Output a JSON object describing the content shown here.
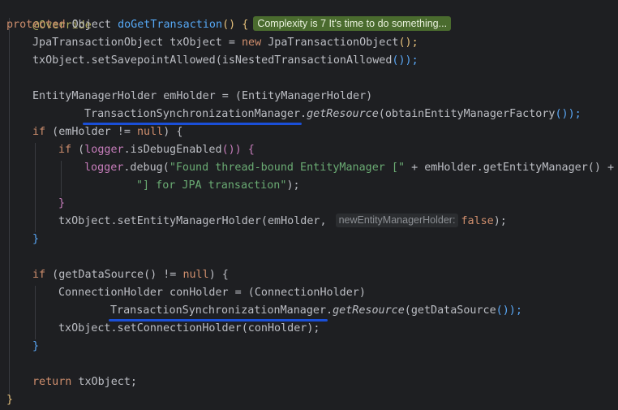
{
  "code": {
    "annotation": "@Override",
    "sig_protected": "protected",
    "sig_type": " Object ",
    "sig_method": "doGetTransaction",
    "sig_parens": "() {",
    "complexity_badge": "Complexity is 7 It's time to do something...",
    "l3_a": "JpaTransactionObject txObject = ",
    "l3_new": "new",
    "l3_b": " JpaTransactionObject",
    "l3_c": "();",
    "l4_a": "txObject.setSavepointAllowed",
    "l4_b": "(isNestedTransactionAllowed",
    "l4_c": "());",
    "l6_a": "EntityManagerHolder emHolder = ",
    "l6_b": "(EntityManagerHolder)",
    "l7_cls": "TransactionSynchronizationManager",
    "l7_dot": ".",
    "l7_m": "getResource",
    "l7_b": "(obtainEntityManagerFactory",
    "l7_c": "());",
    "l8_if": "if",
    "l8_a": " (emHolder != ",
    "l8_null": "null",
    "l8_b": ") {",
    "l9_if": "if",
    "l9_a": " (",
    "l9_logger": "logger",
    "l9_b": ".isDebugEnabled",
    "l9_c": "()) {",
    "l10_logger": "logger",
    "l10_a": ".debug(",
    "l10_str": "\"Found thread-bound EntityManager [\"",
    "l10_b": " + emHolder.getEntityManager() +",
    "l11_str": "\"] for JPA transaction\"",
    "l11_b": ");",
    "l12": "}",
    "l13_a": "txObject.setEntityManagerHolder(emHolder, ",
    "l13_hint": "newEntityManagerHolder:",
    "l13_false": "false",
    "l13_b": ");",
    "l14": "}",
    "l16_if": "if",
    "l16_a": " (getDataSource",
    "l16_b": "() != ",
    "l16_null": "null",
    "l16_c": ") {",
    "l17_a": "ConnectionHolder conHolder = ",
    "l17_b": "(ConnectionHolder)",
    "l18_cls": "TransactionSynchronizationManager",
    "l18_dot": ".",
    "l18_m": "getResource",
    "l18_b": "(getDataSource",
    "l18_c": "());",
    "l19_a": "txObject.setConnectionHolder",
    "l19_b": "(conHolder);",
    "l20": "}",
    "l22_ret": "return",
    "l22_a": " txObject;",
    "l23": "}"
  }
}
